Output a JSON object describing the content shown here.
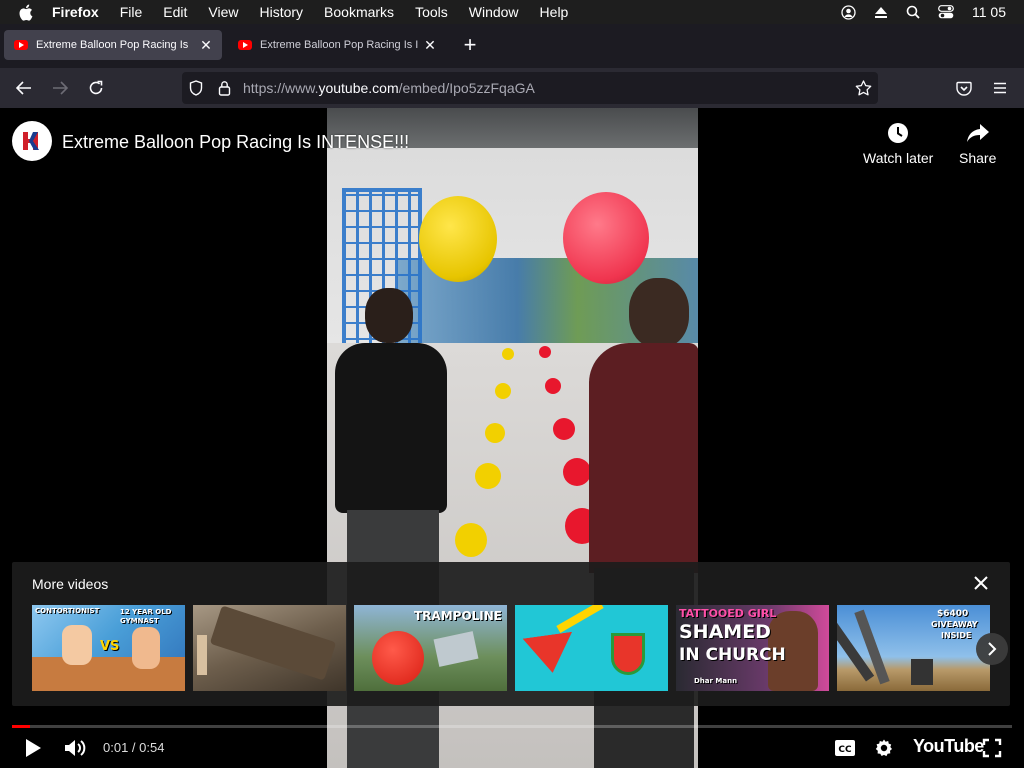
{
  "menubar": {
    "app_name": "Firefox",
    "items": [
      "File",
      "Edit",
      "View",
      "History",
      "Bookmarks",
      "Tools",
      "Window",
      "Help"
    ],
    "clock": "11 05"
  },
  "tabs": [
    {
      "title": "Extreme Balloon Pop Racing Is",
      "active": true
    },
    {
      "title": "Extreme Balloon Pop Racing Is I",
      "active": false
    }
  ],
  "navbar": {
    "url_prefix": "https://www.",
    "url_host": "youtube.com",
    "url_path": "/embed/Ipo5zzFqaGA"
  },
  "player": {
    "video_title": "Extreme Balloon Pop Racing Is INTENSE!!!",
    "watch_later_label": "Watch later",
    "share_label": "Share",
    "more_videos_label": "More videos",
    "current_time": "0:01",
    "duration": "0:54",
    "time_display": "0:01 / 0:54",
    "progress_fraction": 0.018,
    "brand_label": "YouTube",
    "accent_color": "#ff0000"
  },
  "thumbnails": [
    {
      "caption_a": "CONTORTIONIST",
      "caption_b": "12 YEAR OLD GYMNAST",
      "badge": "VS"
    },
    {
      "caption_a": ""
    },
    {
      "caption_a": "TRAMPOLINE"
    },
    {
      "caption_a": ""
    },
    {
      "caption_a": "TATTOOED GIRL",
      "caption_b": "SHAMED",
      "caption_c": "IN CHURCH",
      "tag": "Dhar Mann"
    },
    {
      "caption_a": "$6400",
      "caption_b": "GIVEAWAY",
      "caption_c": "INSIDE"
    }
  ],
  "icons": {
    "apple": "apple-icon",
    "back": "back-arrow-icon",
    "forward": "forward-arrow-icon",
    "reload": "reload-icon",
    "shield": "shield-icon",
    "lock": "lock-icon",
    "bookmark": "star-icon",
    "pocket": "pocket-icon",
    "menu": "hamburger-icon",
    "play": "play-icon",
    "volume": "volume-icon",
    "cc": "cc-icon",
    "settings": "gear-icon",
    "fullscreen": "fullscreen-icon"
  }
}
